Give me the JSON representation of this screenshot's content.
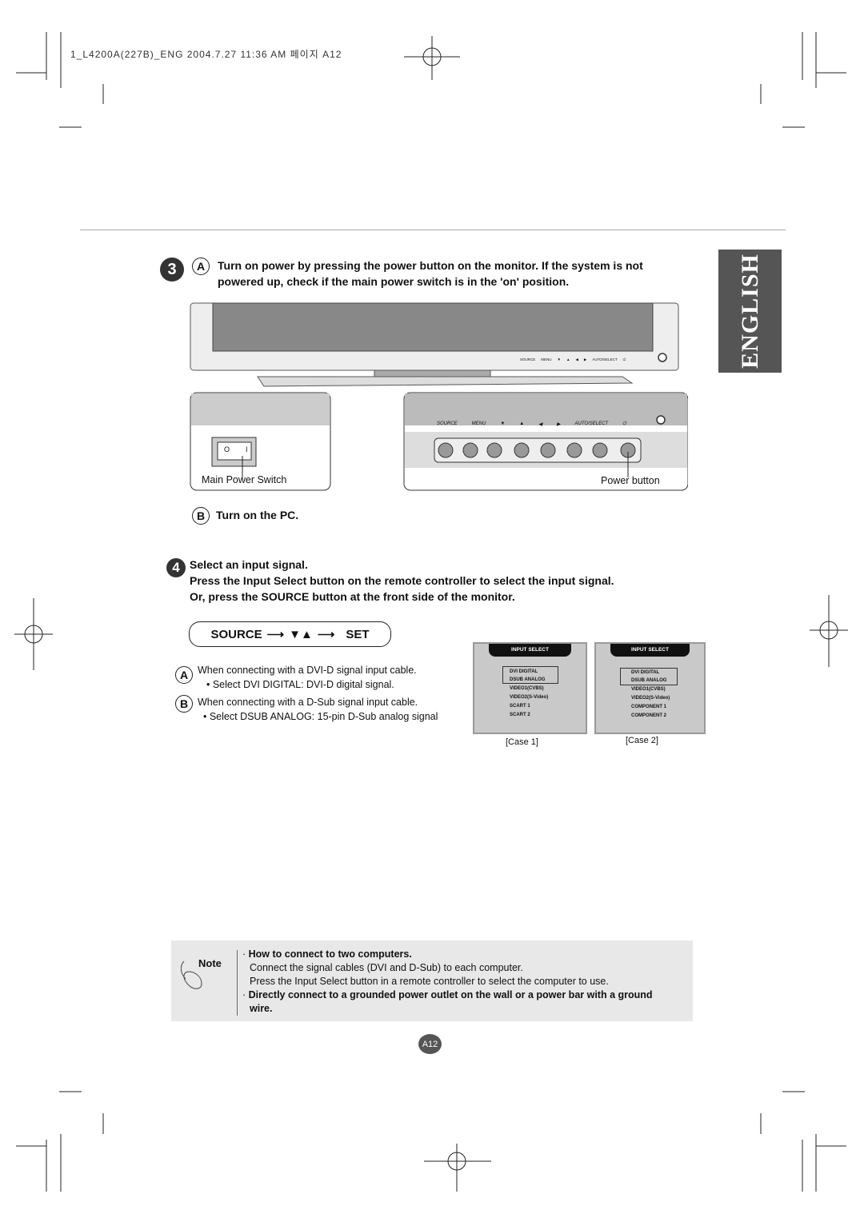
{
  "header": {
    "slug": "1_L4200A(227B)_ENG  2004.7.27 11:36 AM 페이지 A12"
  },
  "side_tab": {
    "label": "ENGLISH"
  },
  "step3": {
    "number": "3",
    "a_marker": "A",
    "a_line1": "Turn on power by pressing the power button on the monitor. If the system is not",
    "a_line2": "powered up, check if the main power switch is in the 'on' position.",
    "b_marker": "B",
    "b_text": "Turn on the PC."
  },
  "figure": {
    "front_labels": [
      "SOURCE",
      "MENU",
      "▼",
      "▲",
      "◀",
      "▶",
      "AUTO/SELECT",
      "⏻"
    ],
    "main_switch_label": "Main Power Switch",
    "power_button_label": "Power button",
    "switch_marks": [
      "O",
      "I"
    ]
  },
  "step4": {
    "number": "4",
    "title": "Select an input signal.",
    "line1": "Press the Input Select button on the remote controller to select the input signal.",
    "line2": "Or, press the SOURCE button at the front side of the monitor."
  },
  "sequence": {
    "source": "SOURCE",
    "arrow": "⟶",
    "updown": "▼▲",
    "set": "SET"
  },
  "options": {
    "a_marker": "A",
    "a_text": "When connecting with a DVI-D signal input cable.",
    "a_bullet": "• Select DVI DIGITAL: DVI-D digital signal.",
    "b_marker": "B",
    "b_text": "When connecting with a D-Sub signal input cable.",
    "b_bullet": "• Select DSUB ANALOG: 15-pin D-Sub analog signal"
  },
  "cases": [
    {
      "title": "INPUT SELECT",
      "items": [
        "DVI DIGITAL",
        "DSUB ANALOG",
        "VIDEO1(CVBS)",
        "VIDEO2(S-Video)",
        "SCART 1",
        "SCART 2"
      ],
      "label": "[Case 1]"
    },
    {
      "title": "INPUT SELECT",
      "items": [
        "DVI DIGITAL",
        "DSUB ANALOG",
        "VIDEO1(CVBS)",
        "VIDEO2(S-Video)",
        "COMPONENT 1",
        "COMPONENT 2"
      ],
      "label": "[Case 2]"
    }
  ],
  "note": {
    "label": "Note",
    "b1_title": "How to connect to two computers.",
    "b1_line1": "Connect the signal cables (DVI and D-Sub) to each computer.",
    "b1_line2": "Press the Input Select button in a remote controller to select the computer to use.",
    "b2_line1": "Directly connect to a grounded power outlet on the wall or a power bar with a ground",
    "b2_line2": "wire."
  },
  "page_number": "A12"
}
